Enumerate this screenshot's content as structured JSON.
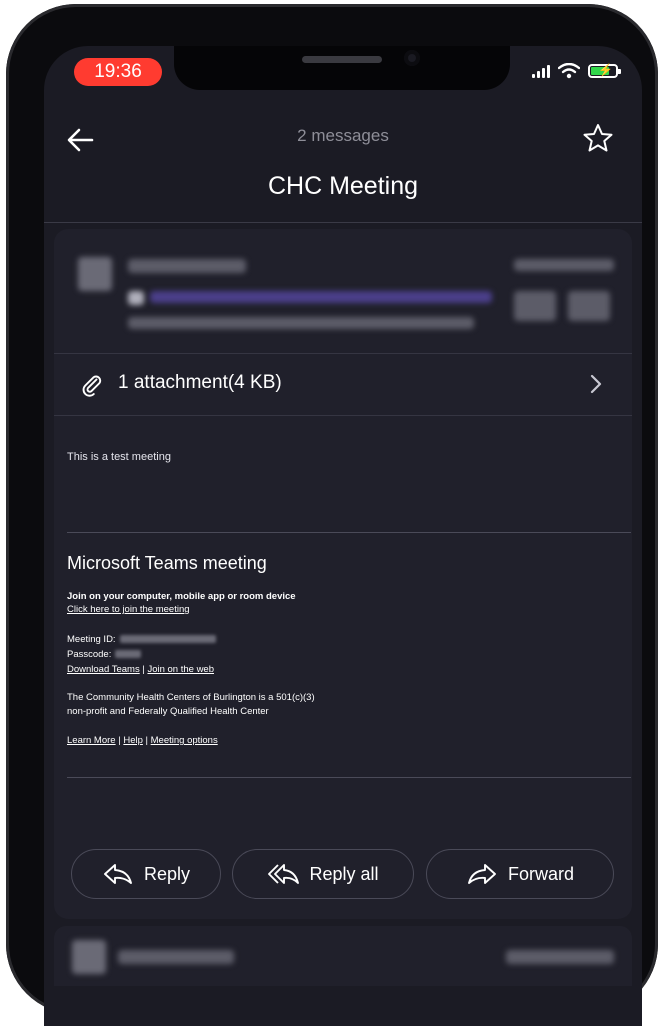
{
  "status_bar": {
    "time": "19:36"
  },
  "header": {
    "message_count": "2 messages",
    "title": "CHC Meeting"
  },
  "attachment": {
    "label": "1 attachment(4 KB)"
  },
  "body": {
    "intro": "This is a test meeting",
    "teams": {
      "title": "Microsoft Teams meeting",
      "join_heading": "Join on your computer, mobile app or room device",
      "join_link": "Click here to join the meeting",
      "meeting_id_label": "Meeting ID:",
      "passcode_label": "Passcode:",
      "download_link": "Download Teams",
      "separator": "|",
      "web_link": "Join on the web",
      "org_line1": "The Community Health Centers of Burlington is a 501(c)(3)",
      "org_line2": "non-profit and Federally Qualified Health Center",
      "learn_more": "Learn More",
      "help": "Help",
      "meeting_options": "Meeting options"
    }
  },
  "actions": {
    "reply": "Reply",
    "reply_all": "Reply all",
    "forward": "Forward"
  },
  "colors": {
    "background": "#1b1b24",
    "card": "#20202b",
    "time_pill": "#ff3b30",
    "battery": "#32d74b"
  },
  "icons": [
    "back-arrow-icon",
    "star-icon",
    "paperclip-icon",
    "chevron-right-icon",
    "reply-icon",
    "reply-all-icon",
    "forward-icon"
  ]
}
